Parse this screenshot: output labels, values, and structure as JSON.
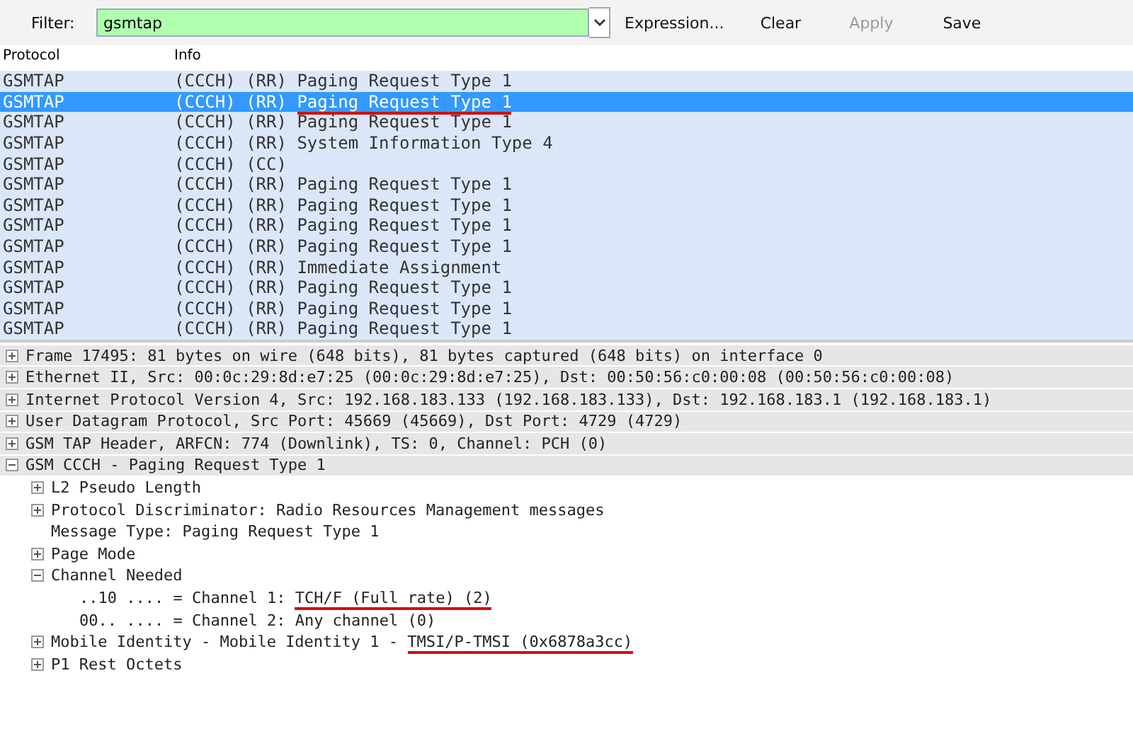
{
  "toolbar": {
    "filter_label": "Filter:",
    "filter_value": "gsmtap",
    "buttons": [
      {
        "label": "Expression...",
        "disabled": false
      },
      {
        "label": "Clear",
        "disabled": false
      },
      {
        "label": "Apply",
        "disabled": true
      },
      {
        "label": "Save",
        "disabled": false
      }
    ]
  },
  "packet_list": {
    "columns": [
      "Protocol",
      "Info"
    ],
    "rows": [
      {
        "protocol": "GSMTAP",
        "info": "(CCCH) (RR) Paging Request Type 1",
        "selected": false
      },
      {
        "protocol": "GSMTAP",
        "info": "(CCCH) (RR) ",
        "annotated": "Paging Request Type 1",
        "selected": true
      },
      {
        "protocol": "GSMTAP",
        "info": "(CCCH) (RR) Paging Request Type 1",
        "selected": false
      },
      {
        "protocol": "GSMTAP",
        "info": "(CCCH) (RR) System Information Type 4",
        "selected": false
      },
      {
        "protocol": "GSMTAP",
        "info": "(CCCH) (CC)",
        "selected": false
      },
      {
        "protocol": "GSMTAP",
        "info": "(CCCH) (RR) Paging Request Type 1",
        "selected": false
      },
      {
        "protocol": "GSMTAP",
        "info": "(CCCH) (RR) Paging Request Type 1",
        "selected": false
      },
      {
        "protocol": "GSMTAP",
        "info": "(CCCH) (RR) Paging Request Type 1",
        "selected": false
      },
      {
        "protocol": "GSMTAP",
        "info": "(CCCH) (RR) Paging Request Type 1",
        "selected": false
      },
      {
        "protocol": "GSMTAP",
        "info": "(CCCH) (RR) Immediate Assignment",
        "selected": false
      },
      {
        "protocol": "GSMTAP",
        "info": "(CCCH) (RR) Paging Request Type 1",
        "selected": false
      },
      {
        "protocol": "GSMTAP",
        "info": "(CCCH) (RR) Paging Request Type 1",
        "selected": false
      },
      {
        "protocol": "GSMTAP",
        "info": "(CCCH) (RR) Paging Request Type 1",
        "selected": false
      }
    ]
  },
  "packet_details": [
    {
      "text": "Frame 17495: 81 bytes on wire (648 bits), 81 bytes captured (648 bits) on interface 0",
      "expanded": false
    },
    {
      "text": "Ethernet II, Src: 00:0c:29:8d:e7:25 (00:0c:29:8d:e7:25), Dst: 00:50:56:c0:00:08 (00:50:56:c0:00:08)",
      "expanded": false
    },
    {
      "text": "Internet Protocol Version 4, Src: 192.168.183.133 (192.168.183.133), Dst: 192.168.183.1 (192.168.183.1)",
      "expanded": false
    },
    {
      "text": "User Datagram Protocol, Src Port: 45669 (45669), Dst Port: 4729 (4729)",
      "expanded": false
    },
    {
      "text": "GSM TAP Header, ARFCN: 774 (Downlink), TS: 0, Channel: PCH (0)",
      "expanded": false
    },
    {
      "text": "GSM CCCH - Paging Request Type 1",
      "expanded": true,
      "children": [
        {
          "text": "L2 Pseudo Length",
          "expanded": false
        },
        {
          "text": "Protocol Discriminator: Radio Resources Management messages",
          "expanded": false
        },
        {
          "text": "Message Type: Paging Request Type 1"
        },
        {
          "text": "Page Mode",
          "expanded": false
        },
        {
          "text": "Channel Needed",
          "expanded": true,
          "children": [
            {
              "text": "..10 .... = Channel 1: ",
              "annotated": "TCH/F (Full rate) (2)"
            },
            {
              "text": "00.. .... = Channel 2: Any channel (0)"
            }
          ]
        },
        {
          "text": "Mobile Identity - Mobile Identity 1 - ",
          "annotated": "TMSI/P-TMSI (0x6878a3cc)",
          "expanded": false
        },
        {
          "text": "P1 Rest Octets",
          "expanded": false
        }
      ]
    }
  ]
}
